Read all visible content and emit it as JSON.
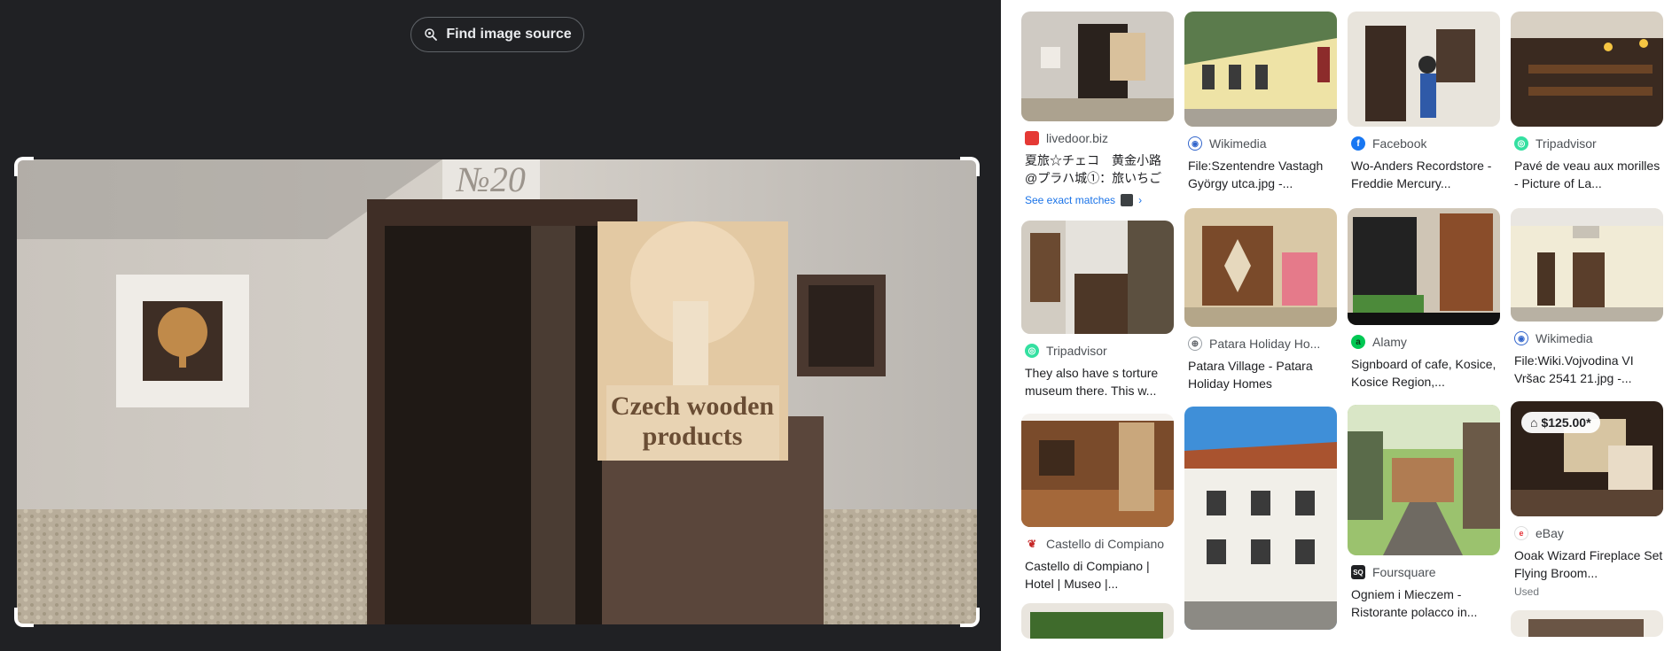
{
  "toolbar": {
    "find_source_label": "Find image source"
  },
  "main_image": {
    "sign_number": "№20",
    "sign_text_line1": "Czech wooden",
    "sign_text_line2": "products"
  },
  "results": [
    {
      "source": "livedoor.biz",
      "title": "夏旅☆チェコ　黄金小路@プラハ城①：旅いちご",
      "exact_link": "See exact matches",
      "fav_color": "#e53935"
    },
    {
      "source": "Tripadvisor",
      "title": "They also have s torture museum there. This w...",
      "fav_color": "#34e0a1"
    },
    {
      "source": "Castello di Compiano",
      "title": "Castello di Compiano | Hotel | Museo |...",
      "fav_color": "#c62828"
    },
    {
      "source": "Wikimedia",
      "title": "File:Szentendre Vastagh György utca.jpg -...",
      "fav_color": "#3366cc"
    },
    {
      "source": "Patara Holiday Ho...",
      "title": "Patara Village - Patara Holiday Homes",
      "fav_color": "#5f6368"
    },
    {
      "source": "Facebook",
      "title": "Wo-Anders Recordstore - Freddie Mercury...",
      "fav_color": "#1877f2"
    },
    {
      "source": "Alamy",
      "title": "Signboard of cafe, Kosice, Kosice Region,...",
      "fav_color": "#00c853"
    },
    {
      "source": "Foursquare",
      "title": "Ogniem i Mieczem - Ristorante polacco in...",
      "fav_color": "#202124"
    },
    {
      "source": "Tripadvisor",
      "title": "Pavé de veau aux morilles - Picture of La...",
      "fav_color": "#34e0a1"
    },
    {
      "source": "Wikimedia",
      "title": "File:Wiki.Vojvodina VI Vršac 2541 21.jpg -...",
      "fav_color": "#3366cc"
    },
    {
      "source": "eBay",
      "title": "Ooak Wizard Fireplace Set Flying Broom...",
      "price": "$125.00*",
      "condition": "Used",
      "fav_color": "#e53238"
    }
  ]
}
